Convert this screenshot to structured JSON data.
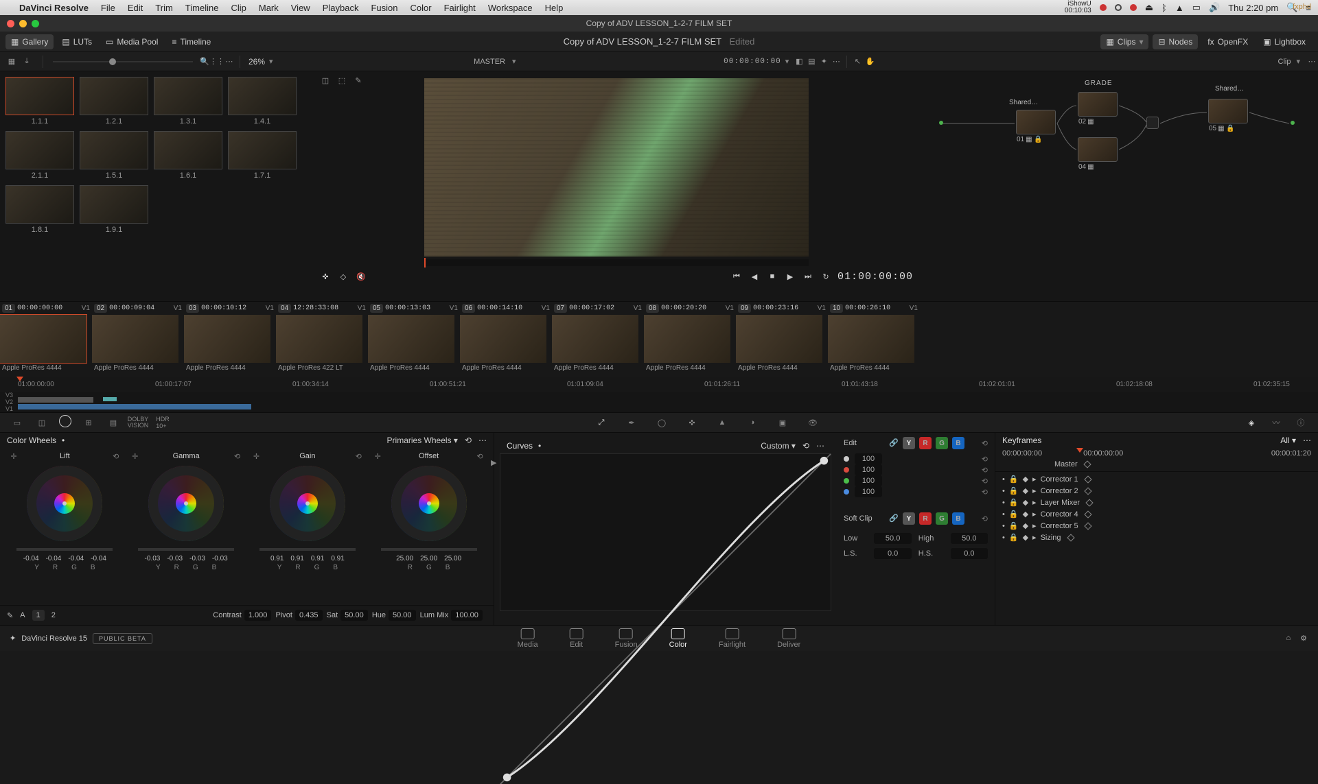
{
  "mac": {
    "app": "DaVinci Resolve",
    "menus": [
      "File",
      "Edit",
      "Trim",
      "Timeline",
      "Clip",
      "Mark",
      "View",
      "Playback",
      "Fusion",
      "Color",
      "Fairlight",
      "Workspace",
      "Help"
    ],
    "recorder": {
      "name": "iShowU",
      "tc": "00:10:03"
    },
    "clock": "Thu 2:20 pm"
  },
  "window": {
    "title": "Copy of ADV LESSON_1-2-7 FILM SET"
  },
  "toolbar": {
    "left": [
      {
        "id": "gallery",
        "label": "Gallery",
        "active": true
      },
      {
        "id": "luts",
        "label": "LUTs",
        "active": false
      },
      {
        "id": "mediapool",
        "label": "Media Pool",
        "active": false
      },
      {
        "id": "timeline",
        "label": "Timeline",
        "active": false
      }
    ],
    "title": "Copy of ADV LESSON_1-2-7 FILM SET",
    "title_status": "Edited",
    "right": [
      {
        "id": "clips",
        "label": "Clips",
        "active": true
      },
      {
        "id": "nodes",
        "label": "Nodes",
        "active": true
      },
      {
        "id": "openfx",
        "label": "OpenFX",
        "active": false
      },
      {
        "id": "lightbox",
        "label": "Lightbox",
        "active": false
      }
    ]
  },
  "subbar": {
    "zoom": "26%",
    "master_label": "MASTER",
    "tc": "00:00:00:00",
    "node_scope": "Clip"
  },
  "gallery": {
    "stills": [
      {
        "label": "1.1.1",
        "selected": true
      },
      {
        "label": "1.2.1"
      },
      {
        "label": "1.3.1"
      },
      {
        "label": "1.4.1"
      },
      {
        "label": "2.1.1"
      },
      {
        "label": "1.5.1"
      },
      {
        "label": "1.6.1"
      },
      {
        "label": "1.7.1"
      },
      {
        "label": "1.8.1"
      },
      {
        "label": "1.9.1"
      }
    ]
  },
  "viewer": {
    "tc": "01:00:00:00"
  },
  "nodes": {
    "group_label": "GRADE",
    "items": [
      {
        "num": "01"
      },
      {
        "num": "02"
      },
      {
        "num": "04"
      },
      {
        "num": "05"
      }
    ],
    "shared": [
      "Shared…",
      "Shared…"
    ]
  },
  "clips": {
    "items": [
      {
        "idx": "01",
        "tc": "00:00:00:00",
        "track": "V1",
        "codec": "Apple ProRes 4444",
        "active": true
      },
      {
        "idx": "02",
        "tc": "00:00:09:04",
        "track": "V1",
        "codec": "Apple ProRes 4444"
      },
      {
        "idx": "03",
        "tc": "00:00:10:12",
        "track": "V1",
        "codec": "Apple ProRes 4444"
      },
      {
        "idx": "04",
        "tc": "12:28:33:08",
        "track": "V1",
        "codec": "Apple ProRes 422 LT"
      },
      {
        "idx": "05",
        "tc": "00:00:13:03",
        "track": "V1",
        "codec": "Apple ProRes 4444"
      },
      {
        "idx": "06",
        "tc": "00:00:14:10",
        "track": "V1",
        "codec": "Apple ProRes 4444"
      },
      {
        "idx": "07",
        "tc": "00:00:17:02",
        "track": "V1",
        "codec": "Apple ProRes 4444"
      },
      {
        "idx": "08",
        "tc": "00:00:20:20",
        "track": "V1",
        "codec": "Apple ProRes 4444"
      },
      {
        "idx": "09",
        "tc": "00:00:23:16",
        "track": "V1",
        "codec": "Apple ProRes 4444"
      },
      {
        "idx": "10",
        "tc": "00:00:26:10",
        "track": "V1",
        "codec": "Apple ProRes 4444"
      }
    ]
  },
  "ruler": {
    "ticks": [
      "01:00:00:00",
      "01:00:17:07",
      "01:00:34:14",
      "01:00:51:21",
      "01:01:09:04",
      "01:01:26:11",
      "01:01:43:18",
      "01:02:01:01",
      "01:02:18:08",
      "01:02:35:15"
    ],
    "tracks": [
      "V3",
      "V2",
      "V1"
    ]
  },
  "wheels": {
    "title": "Color Wheels",
    "mode": "Primaries Wheels",
    "items": [
      {
        "name": "Lift",
        "vals": [
          "-0.04",
          "-0.04",
          "-0.04",
          "-0.04"
        ],
        "ch": [
          "Y",
          "R",
          "G",
          "B"
        ]
      },
      {
        "name": "Gamma",
        "vals": [
          "-0.03",
          "-0.03",
          "-0.03",
          "-0.03"
        ],
        "ch": [
          "Y",
          "R",
          "G",
          "B"
        ]
      },
      {
        "name": "Gain",
        "vals": [
          "0.91",
          "0.91",
          "0.91",
          "0.91"
        ],
        "ch": [
          "Y",
          "R",
          "G",
          "B"
        ]
      },
      {
        "name": "Offset",
        "vals": [
          "25.00",
          "25.00",
          "25.00"
        ],
        "ch": [
          "R",
          "G",
          "B"
        ]
      }
    ],
    "params": [
      {
        "label": "Contrast",
        "val": "1.000"
      },
      {
        "label": "Pivot",
        "val": "0.435"
      },
      {
        "label": "Sat",
        "val": "50.00"
      },
      {
        "label": "Hue",
        "val": "50.00"
      },
      {
        "label": "Lum Mix",
        "val": "100.00"
      }
    ],
    "pages": [
      "1",
      "2"
    ]
  },
  "curves": {
    "title": "Curves",
    "mode": "Custom",
    "edit_label": "Edit",
    "softclip_label": "Soft Clip",
    "channels": [
      "Y",
      "R",
      "G",
      "B"
    ],
    "intensity": [
      {
        "color": "#ccc",
        "val": "100"
      },
      {
        "color": "#d94a3e",
        "val": "100"
      },
      {
        "color": "#4bbf4b",
        "val": "100"
      },
      {
        "color": "#4a8be0",
        "val": "100"
      }
    ],
    "soft": [
      {
        "label": "Low",
        "val": "50.0"
      },
      {
        "label": "High",
        "val": "50.0"
      },
      {
        "label": "L.S.",
        "val": "0.0"
      },
      {
        "label": "H.S.",
        "val": "0.0"
      }
    ]
  },
  "keyframes": {
    "title": "Keyframes",
    "filter": "All",
    "tc_start": "00:00:00:00",
    "tc_play": "00:00:00:00",
    "tc_end": "00:00:01:20",
    "master": "Master",
    "rows": [
      "Corrector 1",
      "Corrector 2",
      "Layer Mixer",
      "Corrector 4",
      "Corrector 5",
      "Sizing"
    ]
  },
  "footer": {
    "brand": "DaVinci Resolve 15",
    "badge": "PUBLIC BETA",
    "pages": [
      {
        "id": "media",
        "label": "Media"
      },
      {
        "id": "edit",
        "label": "Edit"
      },
      {
        "id": "fusion",
        "label": "Fusion"
      },
      {
        "id": "color",
        "label": "Color",
        "active": true
      },
      {
        "id": "fairlight",
        "label": "Fairlight"
      },
      {
        "id": "deliver",
        "label": "Deliver"
      }
    ]
  }
}
